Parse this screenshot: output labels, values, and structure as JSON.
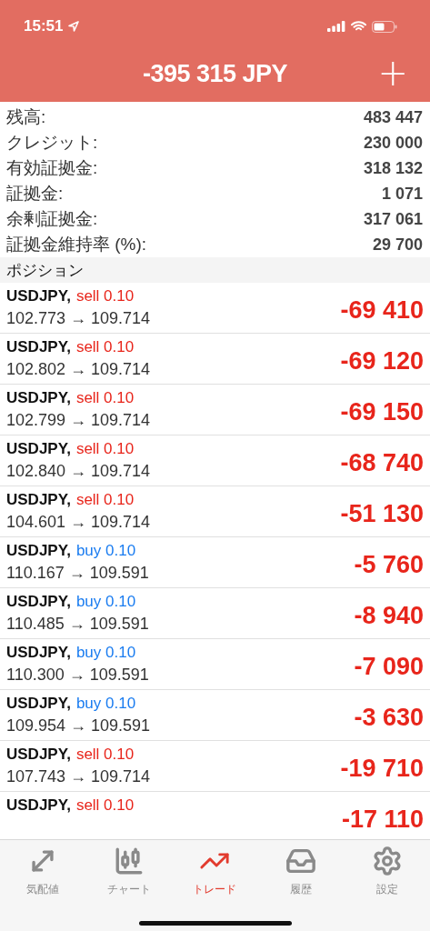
{
  "status_bar": {
    "time": "15:51"
  },
  "header": {
    "title": "-395 315 JPY",
    "add_button": "+"
  },
  "summary": [
    {
      "label": "残高:",
      "value": "483 447"
    },
    {
      "label": "クレジット:",
      "value": "230 000"
    },
    {
      "label": "有効証拠金:",
      "value": "318 132"
    },
    {
      "label": "証拠金:",
      "value": "1 071"
    },
    {
      "label": "余剰証拠金:",
      "value": "317 061"
    },
    {
      "label": "証拠金維持率 (%):",
      "value": "29 700"
    }
  ],
  "positions_header": "ポジション",
  "positions": [
    {
      "symbol": "USDJPY,",
      "kind": "sell",
      "order": "sell 0.10",
      "prices": "102.773 → 109.714",
      "profit": "-69 410"
    },
    {
      "symbol": "USDJPY,",
      "kind": "sell",
      "order": "sell 0.10",
      "prices": "102.802 → 109.714",
      "profit": "-69 120"
    },
    {
      "symbol": "USDJPY,",
      "kind": "sell",
      "order": "sell 0.10",
      "prices": "102.799 → 109.714",
      "profit": "-69 150"
    },
    {
      "symbol": "USDJPY,",
      "kind": "sell",
      "order": "sell 0.10",
      "prices": "102.840 → 109.714",
      "profit": "-68 740"
    },
    {
      "symbol": "USDJPY,",
      "kind": "sell",
      "order": "sell 0.10",
      "prices": "104.601 → 109.714",
      "profit": "-51 130"
    },
    {
      "symbol": "USDJPY,",
      "kind": "buy",
      "order": "buy 0.10",
      "prices": "110.167 → 109.591",
      "profit": "-5 760"
    },
    {
      "symbol": "USDJPY,",
      "kind": "buy",
      "order": "buy 0.10",
      "prices": "110.485 → 109.591",
      "profit": "-8 940"
    },
    {
      "symbol": "USDJPY,",
      "kind": "buy",
      "order": "buy 0.10",
      "prices": "110.300 → 109.591",
      "profit": "-7 090"
    },
    {
      "symbol": "USDJPY,",
      "kind": "buy",
      "order": "buy 0.10",
      "prices": "109.954 → 109.591",
      "profit": "-3 630"
    },
    {
      "symbol": "USDJPY,",
      "kind": "sell",
      "order": "sell 0.10",
      "prices": "107.743 → 109.714",
      "profit": "-19 710"
    },
    {
      "symbol": "USDJPY,",
      "kind": "sell",
      "order": "sell 0.10",
      "profit": "-17 110"
    }
  ],
  "tabs": [
    {
      "kind": "quotes",
      "label": "気配値",
      "selected": false
    },
    {
      "kind": "chart",
      "label": "チャート",
      "selected": false
    },
    {
      "kind": "trade",
      "label": "トレード",
      "selected": true
    },
    {
      "kind": "history",
      "label": "履歴",
      "selected": false
    },
    {
      "kind": "settings",
      "label": "設定",
      "selected": false
    }
  ]
}
